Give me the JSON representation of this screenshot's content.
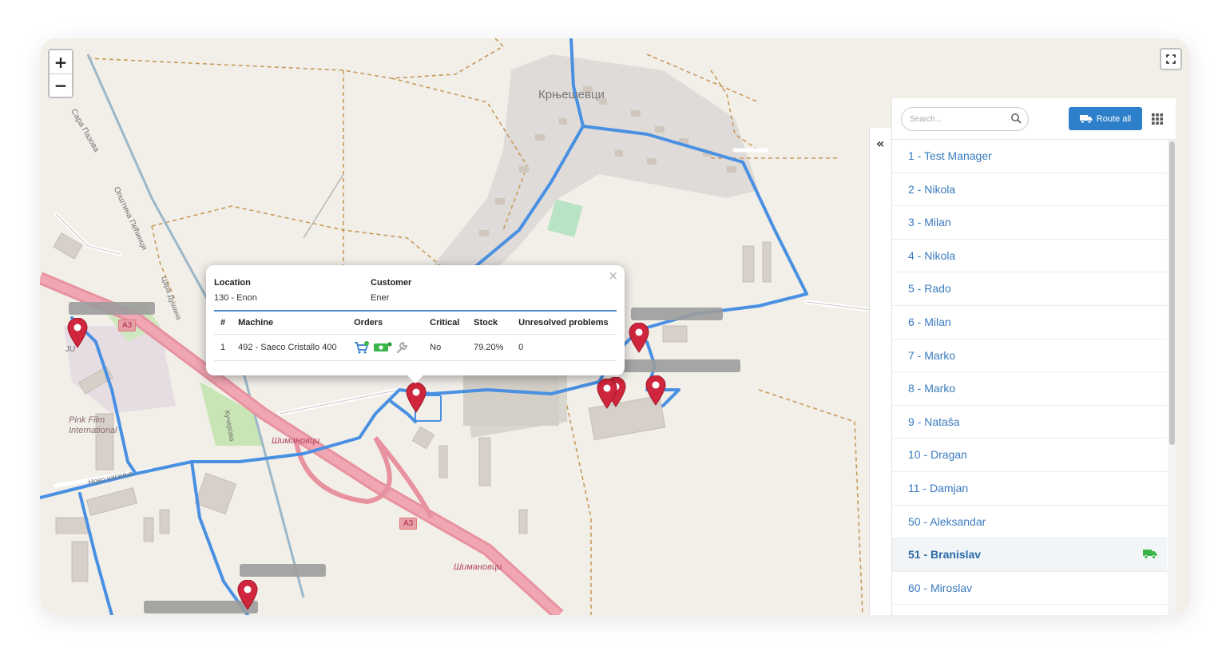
{
  "map": {
    "labels": {
      "village": "Крњешевци",
      "simanovci_1": "Шимановци",
      "simanovci_2": "Шимановци",
      "pink": "Pink Film International",
      "street_1": "Цара Душана",
      "street_2": "Општина Пећинци",
      "street_3": "Новo насеље",
      "street_4": "Кучерова",
      "street_5": "Сарa Пазова",
      "ju": "JU"
    },
    "shields": [
      "A3",
      "A3"
    ],
    "zoom_in": "+",
    "zoom_out": "−"
  },
  "popup": {
    "location_label": "Location",
    "location_value": "130 - Enon",
    "customer_label": "Customer",
    "customer_value": "Ener",
    "close": "×",
    "columns": [
      "#",
      "Machine",
      "Orders",
      "Critical",
      "Stock",
      "Unresolved problems"
    ],
    "rows": [
      {
        "num": "1",
        "machine": "492 - Saeco Cristallo 400",
        "critical": "No",
        "stock": "79.20%",
        "problems": "0"
      }
    ],
    "order_icons": [
      "cart-icon",
      "money-icon",
      "wrench-icon"
    ]
  },
  "panel": {
    "collapse": "«",
    "search_placeholder": "Search...",
    "route_all": "Route all",
    "users": [
      {
        "label": "1 - Test Manager",
        "active": false
      },
      {
        "label": "2 - Nikola",
        "active": false
      },
      {
        "label": "3 - Milan",
        "active": false
      },
      {
        "label": "4 - Nikola",
        "active": false
      },
      {
        "label": "5 - Rado",
        "active": false
      },
      {
        "label": "6 - Milan",
        "active": false
      },
      {
        "label": "7 - Marko",
        "active": false
      },
      {
        "label": "8 - Marko",
        "active": false
      },
      {
        "label": "9 - Nataša",
        "active": false
      },
      {
        "label": "10 - Dragan",
        "active": false
      },
      {
        "label": "11 - Damjan",
        "active": false
      },
      {
        "label": "50 - Aleksandar",
        "active": false
      },
      {
        "label": "51 - Branislav",
        "active": true
      },
      {
        "label": "60 - Miroslav",
        "active": false
      }
    ]
  },
  "colors": {
    "route": "#4a90e2",
    "highway": "#e8929f",
    "marker": "#d0263d",
    "accent": "#2e7fca",
    "truck_active": "#3bb54a"
  }
}
